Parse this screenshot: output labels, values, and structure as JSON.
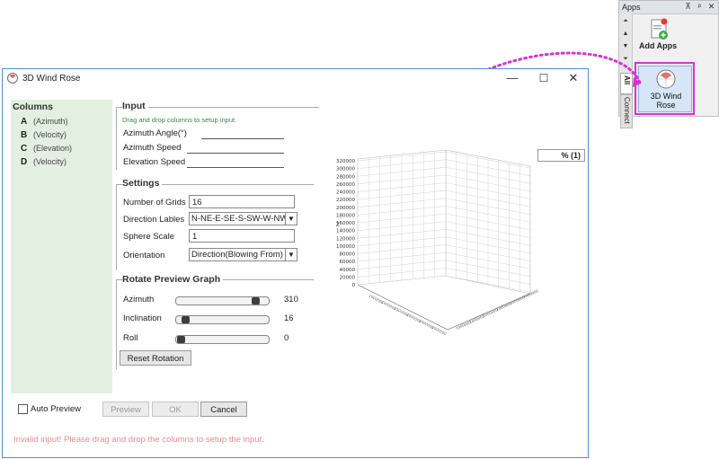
{
  "apps_panel": {
    "title": "Apps",
    "pin_glyph": "⊼",
    "float_glyph": "ᵖ",
    "close_glyph": "✕",
    "tabs": [
      "All",
      "Connect"
    ],
    "tiles": [
      {
        "label": "Add Apps",
        "icon": "add-apps-icon"
      },
      {
        "label": "3D Wind Rose",
        "icon": "wind-rose-icon"
      }
    ]
  },
  "dialog": {
    "title": "3D Wind Rose",
    "controls": {
      "minimize": "—",
      "maximize": "☐",
      "close": "✕"
    },
    "columns": {
      "title": "Columns",
      "items": [
        {
          "letter": "A",
          "desc": "(Azimuth)"
        },
        {
          "letter": "B",
          "desc": "(Velocity)"
        },
        {
          "letter": "C",
          "desc": "(Elevation)"
        },
        {
          "letter": "D",
          "desc": "(Velocity)"
        }
      ]
    },
    "input": {
      "title": "Input",
      "hint": "Drag and drop columns to setup input.",
      "fields": [
        "Azimuth Angle(°)",
        "Azimuth Speed",
        "Elevation Speed"
      ]
    },
    "settings": {
      "title": "Settings",
      "number_of_grids": {
        "label": "Number of Grids",
        "value": "16"
      },
      "direction_labels": {
        "label": "Direction Lables",
        "value": "N-NE-E-SE-S-SW-W-NW"
      },
      "sphere_scale": {
        "label": "Sphere Scale",
        "value": "1"
      },
      "orientation": {
        "label": "Orientation",
        "value": "Direction(Blowing From)"
      }
    },
    "rotate": {
      "title": "Rotate Preview Graph",
      "azimuth": {
        "label": "Azimuth",
        "value": "310",
        "fraction": 0.9
      },
      "inclination": {
        "label": "Inclination",
        "value": "16",
        "fraction": 0.05
      },
      "roll": {
        "label": "Roll",
        "value": "0",
        "fraction": 0.0
      },
      "reset_label": "Reset Rotation"
    },
    "auto_preview": {
      "label": "Auto Preview",
      "checked": false
    },
    "buttons": {
      "preview": "Preview",
      "ok": "OK",
      "cancel": "Cancel"
    },
    "error": "Invalid input! Please drag and drop the columns to setup the input.",
    "graph": {
      "legend": "% (1)",
      "z_axis_label": "Z",
      "z_ticks": [
        "320000",
        "300000",
        "280000",
        "260000",
        "240000",
        "220000",
        "200000",
        "180000",
        "160000",
        "140000",
        "120000",
        "100000",
        "80000",
        "60000",
        "40000",
        "20000",
        "0"
      ]
    }
  },
  "colors": {
    "dialog_border": "#4a90d9",
    "columns_bg": "#e3f0e1",
    "hint_green": "#2e8b3a",
    "error_red": "#f08a8a",
    "highlight_magenta": "#d633d6"
  }
}
